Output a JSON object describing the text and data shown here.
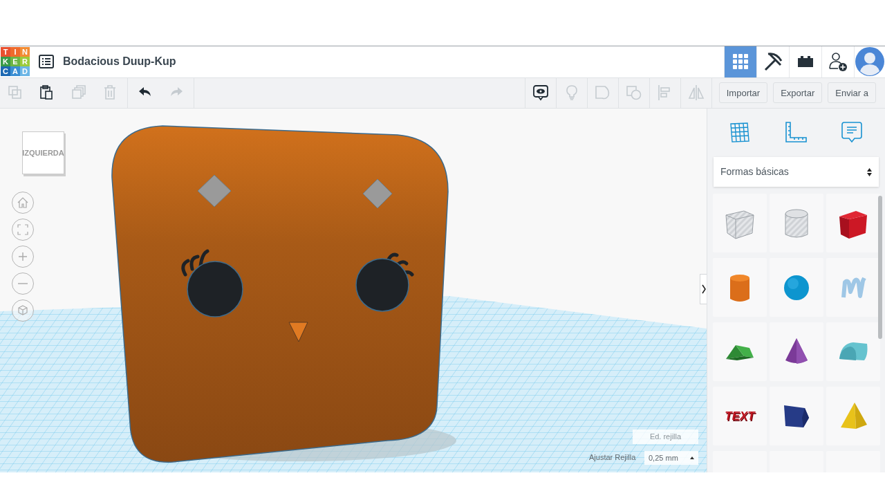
{
  "logo": {
    "tiles": [
      {
        "letter": "T",
        "color": "#e8502f"
      },
      {
        "letter": "I",
        "color": "#ee6a2c"
      },
      {
        "letter": "N",
        "color": "#f28c33"
      },
      {
        "letter": "K",
        "color": "#3a9b48"
      },
      {
        "letter": "E",
        "color": "#6cb544"
      },
      {
        "letter": "R",
        "color": "#9ccb3b"
      },
      {
        "letter": "C",
        "color": "#1d69b3"
      },
      {
        "letter": "A",
        "color": "#3b8fd3"
      },
      {
        "letter": "D",
        "color": "#6cb6e6"
      }
    ]
  },
  "header": {
    "title": "Bodacious Duup-Kup",
    "nav": [
      {
        "kind": "grid",
        "selected": true
      },
      {
        "kind": "pickaxe",
        "selected": false
      },
      {
        "kind": "bricks",
        "selected": false
      },
      {
        "kind": "invite",
        "selected": false
      },
      {
        "kind": "avatar",
        "selected": false
      }
    ]
  },
  "toolbar": {
    "edit_tools": [
      {
        "kind": "copy",
        "disabled": true
      },
      {
        "kind": "paste",
        "disabled": false
      },
      {
        "kind": "duplicate",
        "disabled": true
      },
      {
        "kind": "delete",
        "disabled": true
      }
    ],
    "history_tools": [
      {
        "kind": "undo",
        "disabled": false
      },
      {
        "kind": "redo",
        "disabled": true
      }
    ],
    "shape_tools": [
      {
        "kind": "notes",
        "disabled": false
      },
      {
        "kind": "light",
        "disabled": true
      },
      {
        "kind": "group",
        "disabled": true
      },
      {
        "kind": "ungroup",
        "disabled": true
      },
      {
        "kind": "align",
        "disabled": true
      },
      {
        "kind": "mirror",
        "disabled": true
      }
    ],
    "buttons": [
      "Importar",
      "Exportar",
      "Enviar a"
    ]
  },
  "view_cube": {
    "label": "IZQUIERDA"
  },
  "view_controls": [
    {
      "kind": "home"
    },
    {
      "kind": "fit"
    },
    {
      "kind": "zoom-in"
    },
    {
      "kind": "zoom-out"
    },
    {
      "kind": "ortho"
    }
  ],
  "panel": {
    "tools": [
      {
        "kind": "workplane"
      },
      {
        "kind": "ruler"
      },
      {
        "kind": "notes"
      }
    ],
    "category": "Formas básicas",
    "shapes": [
      {
        "kind": "box-hole"
      },
      {
        "kind": "cylinder-hole"
      },
      {
        "kind": "box"
      },
      {
        "kind": "cylinder"
      },
      {
        "kind": "sphere"
      },
      {
        "kind": "scribble"
      },
      {
        "kind": "roof"
      },
      {
        "kind": "cone"
      },
      {
        "kind": "round-roof"
      },
      {
        "kind": "text",
        "label": "TEXT"
      },
      {
        "kind": "polygon"
      },
      {
        "kind": "pyramid"
      },
      {
        "kind": "cut-off"
      },
      {
        "kind": "cut-off"
      },
      {
        "kind": "cut-off"
      }
    ]
  },
  "grid_controls": {
    "edit_label": "Ed. rejilla",
    "snap_label": "Ajustar Rejilla",
    "snap_value": "0,25 mm"
  }
}
